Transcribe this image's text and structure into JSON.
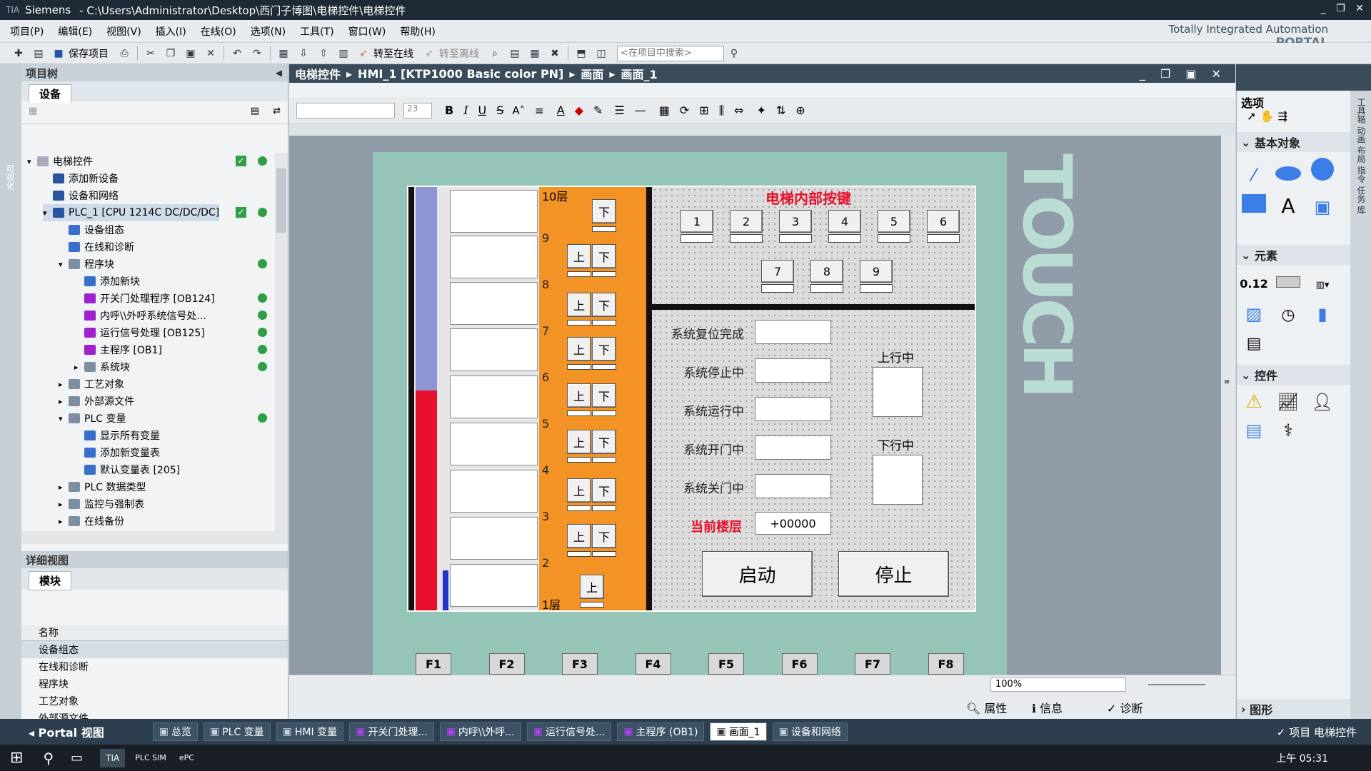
{
  "window": {
    "app": "Siemens",
    "path": "-  C:\\Users\\Administrator\\Desktop\\西门子博图\\电梯控件\\电梯控件",
    "brand_line1": "Totally Integrated Automation",
    "brand_line2": "PORTAL",
    "controls": [
      "_",
      "❐",
      "✕"
    ]
  },
  "menu": [
    "项目(P)",
    "编辑(E)",
    "视图(V)",
    "插入(I)",
    "在线(O)",
    "选项(N)",
    "工具(T)",
    "窗口(W)",
    "帮助(H)"
  ],
  "toolbar": {
    "save_label": "保存项目",
    "go_online": "转至在线",
    "go_offline": "转至离线",
    "search_placeholder": "<在项目中搜索>"
  },
  "project_tree": {
    "title": "项目树",
    "tab": "设备",
    "items": [
      {
        "label": "电梯控件",
        "check": true,
        "dot": true
      },
      {
        "label": "添加新设备"
      },
      {
        "label": "设备和网络"
      },
      {
        "label": "PLC_1 [CPU 1214C DC/DC/DC]",
        "check": true,
        "dot": true
      },
      {
        "label": "设备组态"
      },
      {
        "label": "在线和诊断"
      },
      {
        "label": "程序块",
        "dot": true
      },
      {
        "label": "添加新块"
      },
      {
        "label": "开关门处理程序 [OB124]",
        "dot": true
      },
      {
        "label": "内呼\\\\外呼系统信号处...",
        "dot": true
      },
      {
        "label": "运行信号处理 [OB125]",
        "dot": true
      },
      {
        "label": "主程序 [OB1]",
        "dot": true
      },
      {
        "label": "系统块",
        "dot": true
      },
      {
        "label": "工艺对象"
      },
      {
        "label": "外部源文件"
      },
      {
        "label": "PLC 变量",
        "dot": true
      },
      {
        "label": "显示所有变量"
      },
      {
        "label": "添加新变量表"
      },
      {
        "label": "默认变量表 [205]"
      },
      {
        "label": "PLC 数据类型"
      },
      {
        "label": "监控与强制表"
      },
      {
        "label": "在线备份"
      }
    ]
  },
  "detail_view": {
    "title": "详细视图",
    "tab": "模块",
    "col": "名称",
    "rows": [
      "设备组态",
      "在线和诊断",
      "程序块",
      "工艺对象",
      "外部源文件"
    ]
  },
  "breadcrumb": [
    "电梯控件",
    "HMI_1 [KTP1000 Basic color PN]",
    "画面",
    "画面_1"
  ],
  "format": {
    "font_size": "23"
  },
  "hmi": {
    "panel_label": "TOUCH",
    "floor_top": "10层",
    "floor_bottom": "1层",
    "floor_numbers": [
      "9",
      "8",
      "7",
      "6",
      "5",
      "4",
      "3",
      "2"
    ],
    "up": "上",
    "down": "下",
    "inner_title": "电梯内部按键",
    "inner_buttons": [
      "1",
      "2",
      "3",
      "4",
      "5",
      "6",
      "7",
      "8",
      "9"
    ],
    "status_labels": [
      "系统复位完成",
      "系统停止中",
      "系统运行中",
      "系统开门中",
      "系统关门中"
    ],
    "current_floor_label": "当前楼层",
    "current_floor_value": "+00000",
    "up_running": "上行中",
    "down_running": "下行中",
    "start": "启动",
    "stop": "停止",
    "fkeys": [
      "F1",
      "F2",
      "F3",
      "F4",
      "F5",
      "F6",
      "F7",
      "F8"
    ],
    "level_fraction": 0.52,
    "colors": {
      "screen_bg": "#95c4b8",
      "orange": "#f39325",
      "red": "#e8102a",
      "blue": "#8e95d6",
      "dark_blue": "#2233cc",
      "title_red": "#e8102a"
    }
  },
  "zoom": "100%",
  "right_panel": {
    "title": "选项",
    "basic": "基本对象",
    "elements": "元素",
    "controls": "控件",
    "graphics": "图形"
  },
  "bottom_right_tabs": {
    "props": "属性",
    "info": "信息",
    "diag": "诊断"
  },
  "bottom_tabs": {
    "portal": "Portal 视图",
    "tabs": [
      "总览",
      "PLC 变量",
      "HMI 变量",
      "开关门处理...",
      "内呼\\\\外呼...",
      "运行信号处...",
      "主程序 (OB1)",
      "画面_1",
      "设备和网络"
    ],
    "project": "项目 电梯控件"
  },
  "taskbar": {
    "time": "上午 05:31",
    "apps": [
      "TIA",
      "PLC SIM",
      "ePC"
    ]
  }
}
